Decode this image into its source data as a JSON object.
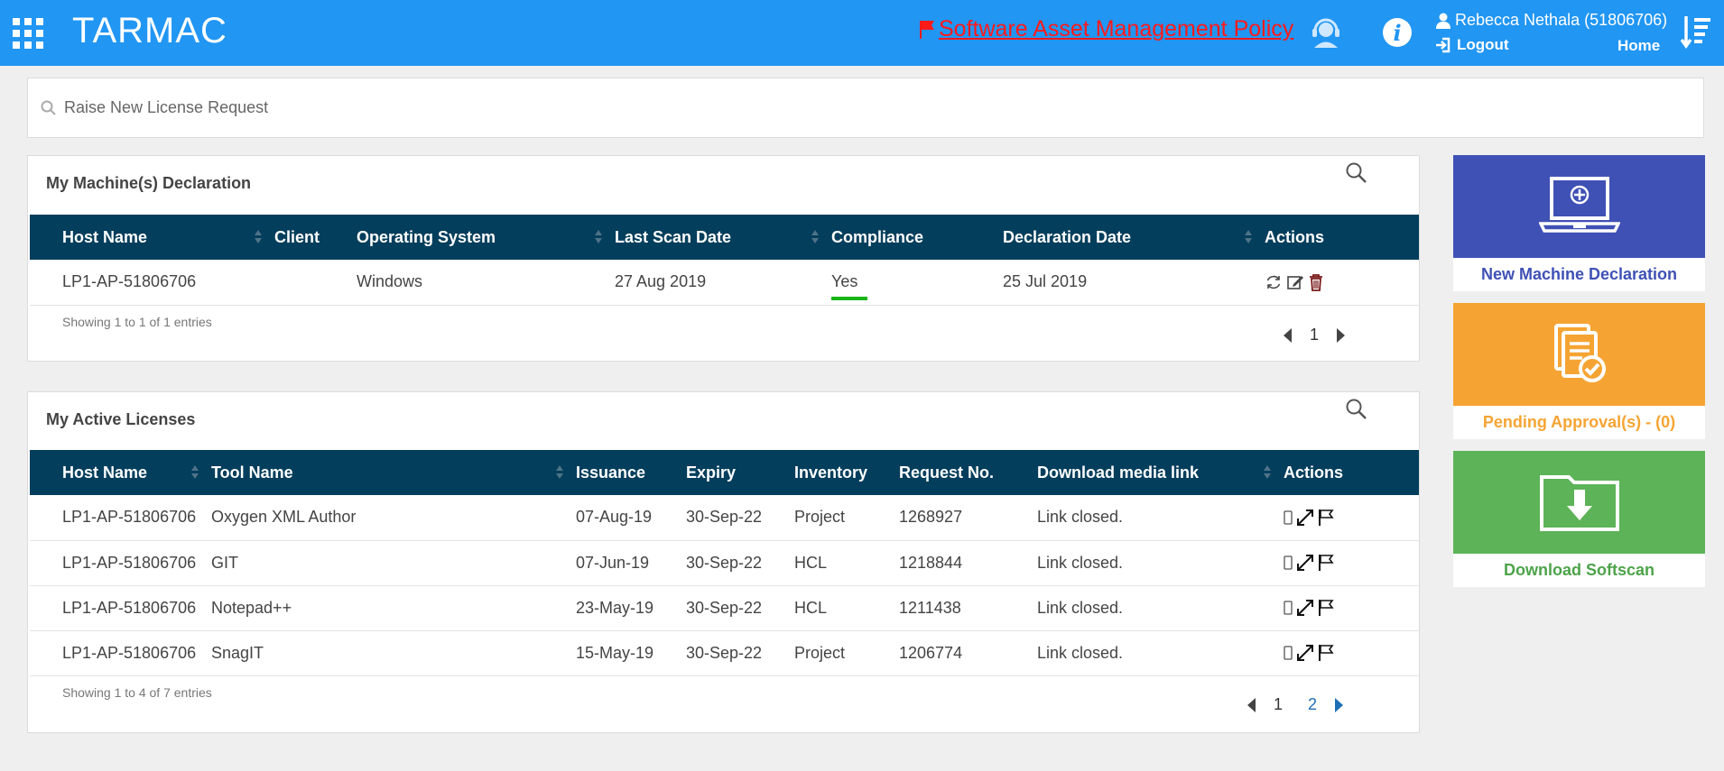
{
  "header": {
    "app_title": "TARMAC",
    "policy_link": "Software Asset Management Policy",
    "user": "Rebecca Nethala (51806706)",
    "logout": "Logout",
    "home": "Home"
  },
  "search": {
    "placeholder": "Raise New License Request"
  },
  "machines": {
    "title": "My Machine(s) Declaration",
    "columns": [
      "Host Name",
      "Client",
      "Operating System",
      "Last Scan Date",
      "Compliance",
      "Declaration Date",
      "Actions"
    ],
    "rows": [
      {
        "host": "LP1-AP-51806706",
        "client": "",
        "os": "Windows",
        "last_scan": "27 Aug 2019",
        "compliance": "Yes",
        "declaration": "25 Jul 2019"
      }
    ],
    "showing": "Showing 1 to 1 of 1 entries",
    "pages": [
      "1"
    ]
  },
  "licenses": {
    "title": "My Active Licenses",
    "columns": [
      "Host Name",
      "Tool Name",
      "Issuance",
      "Expiry",
      "Inventory",
      "Request No.",
      "Download media link",
      "Actions"
    ],
    "rows": [
      {
        "host": "LP1-AP-51806706",
        "tool": "Oxygen XML Author",
        "issuance": "07-Aug-19",
        "expiry": "30-Sep-22",
        "inventory": "Project",
        "request": "1268927",
        "link": "Link closed."
      },
      {
        "host": "LP1-AP-51806706",
        "tool": "GIT",
        "issuance": "07-Jun-19",
        "expiry": "30-Sep-22",
        "inventory": "HCL",
        "request": "1218844",
        "link": "Link closed."
      },
      {
        "host": "LP1-AP-51806706",
        "tool": "Notepad++",
        "issuance": "23-May-19",
        "expiry": "30-Sep-22",
        "inventory": "HCL",
        "request": "1211438",
        "link": "Link closed."
      },
      {
        "host": "LP1-AP-51806706",
        "tool": "SnagIT",
        "issuance": "15-May-19",
        "expiry": "30-Sep-22",
        "inventory": "Project",
        "request": "1206774",
        "link": "Link closed."
      }
    ],
    "showing": "Showing 1 to 4 of 7 entries",
    "pages": [
      "1",
      "2"
    ]
  },
  "cards": {
    "new_machine": "New Machine Declaration",
    "pending": "Pending Approval(s) - (0)",
    "download": "Download Softscan"
  },
  "colors": {
    "header_bg": "#2196f3",
    "table_header_bg": "#033e5c",
    "policy_red": "#ff1a1a",
    "card_blue": "#3f51b5",
    "card_orange": "#f5a433",
    "card_green": "#5db358",
    "compliance_green": "#17b517"
  },
  "icons": {
    "apps": "grid-icon",
    "policy": "flag-icon",
    "support": "headset-icon",
    "info": "info-icon",
    "user": "user-icon",
    "logout": "logout-icon",
    "menu": "sort-list-icon",
    "search": "search-icon",
    "refresh": "refresh-icon",
    "edit": "edit-icon",
    "delete": "trash-icon",
    "mobile": "mobile-icon",
    "expand": "expand-icon",
    "flag": "flag-icon",
    "laptop": "laptop-add-icon",
    "approval": "document-check-icon",
    "download": "folder-download-icon"
  }
}
